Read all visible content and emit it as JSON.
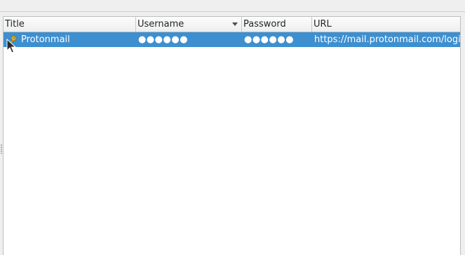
{
  "table": {
    "columns": [
      {
        "label": "Title"
      },
      {
        "label": "Username",
        "sorted": "descending"
      },
      {
        "label": "Password"
      },
      {
        "label": "URL"
      }
    ],
    "rows": [
      {
        "icon": "key-icon",
        "title": "Protonmail",
        "username": "●●●●●●",
        "password": "●●●●●●",
        "url": "https://mail.protonmail.com/login",
        "selected": true
      }
    ]
  },
  "colors": {
    "selection": "#3d8fd0",
    "selection_text": "#ffffff",
    "icon_gold": "#d2b02a"
  }
}
